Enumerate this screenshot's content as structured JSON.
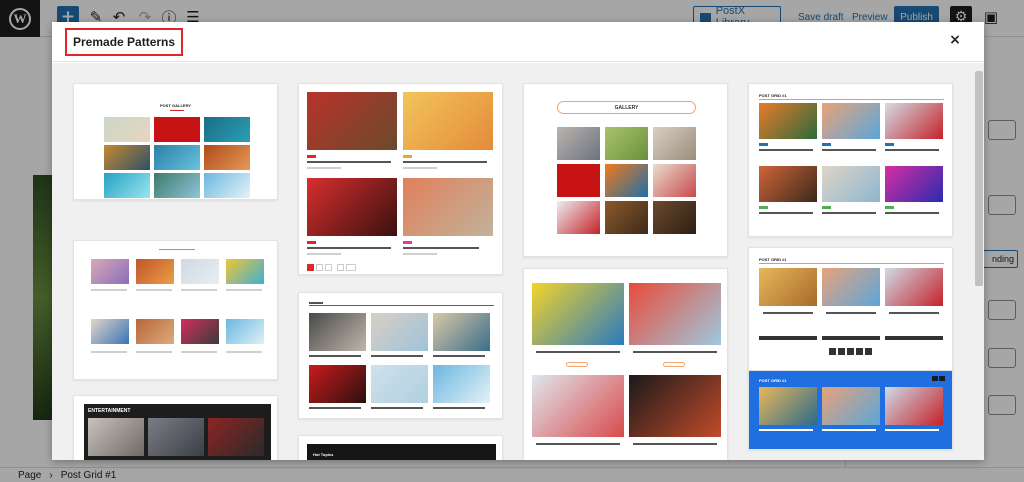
{
  "toolbar": {
    "postx_library": "PostX Library",
    "save_draft": "Save draft",
    "preview": "Preview",
    "publish": "Publish"
  },
  "sidebar": {
    "button_partial": "nding"
  },
  "statusbar": {
    "page": "Page",
    "separator": "›",
    "block": "Post Grid #1"
  },
  "modal": {
    "title": "Premade Patterns",
    "close": "×"
  },
  "patterns": {
    "post_gallery": "POST GALLERY",
    "gallery": "GALLERY",
    "entertainment": "ENTERTAINMENT",
    "hot_topics": "Hot Topics",
    "post_grid": "POST GRID #1"
  },
  "colors": {
    "accent": "#2271b1",
    "highlight_border": "#e0262a",
    "gallery_pill": "#f2a46a",
    "blue_card": "#1f6fe0"
  }
}
